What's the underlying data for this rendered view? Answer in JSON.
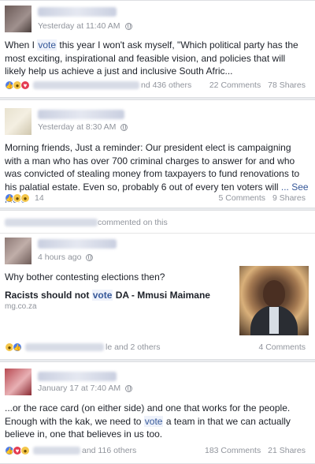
{
  "posts": [
    {
      "timestamp": "Yesterday at 11:40 AM",
      "text_before": "When I ",
      "text_highlight": "vote",
      "text_after": " this year I won't ask myself, \"Which political party has the most exciting, inspirational and feasible vision, and policies that will likely help us achieve a just and inclusive South Afric...",
      "reactions": [
        "like",
        "wow",
        "love"
      ],
      "reaction_text": "nd 436 others",
      "comments": "22 Comments",
      "shares": "78 Shares"
    },
    {
      "timestamp": "Yesterday at 8:30 AM",
      "text": "Morning friends, Just a reminder: Our president elect is campaigning with a man who has over 700 criminal charges to answer for and who was convicted of stealing money from taxpayers to fund renovations to his palatial estate. Even so, probably 6 out of every ten voters will ",
      "ellipsis": "...",
      "see_more": "See More",
      "reactions": [
        "like",
        "wow",
        "haha"
      ],
      "reaction_count": "14",
      "comments": "5 Comments",
      "shares": "9 Shares"
    },
    {
      "activity": "commented on this",
      "timestamp": "4 hours ago",
      "text": "Why bother contesting elections then?",
      "link_title_before": "Racists should not ",
      "link_title_highlight": "vote",
      "link_title_after": " DA - Mmusi Maimane",
      "link_source": "mg.co.za",
      "reactions": [
        "haha",
        "like"
      ],
      "reaction_text": "le and 2 others",
      "comments": "4 Comments"
    },
    {
      "timestamp": "January 17 at 7:40 AM",
      "text_before": "...or the race card (on either side) and one that works for the people. Enough with the kak, we need to ",
      "text_highlight": "vote",
      "text_after": " a team in that we can actually believe in, one that believes in us too.",
      "reactions": [
        "like",
        "love",
        "wow"
      ],
      "reaction_text": "and 116 others",
      "comments": "183 Comments",
      "shares": "21 Shares"
    }
  ],
  "icons": {
    "privacy": "globe-icon",
    "like": "like-icon",
    "love": "love-icon",
    "wow": "wow-icon",
    "haha": "haha-icon"
  },
  "colors": {
    "link": "#365899",
    "meta": "#90949c",
    "like": "#4f7de8",
    "love": "#e43c52",
    "emoji": "#f4c64a"
  }
}
